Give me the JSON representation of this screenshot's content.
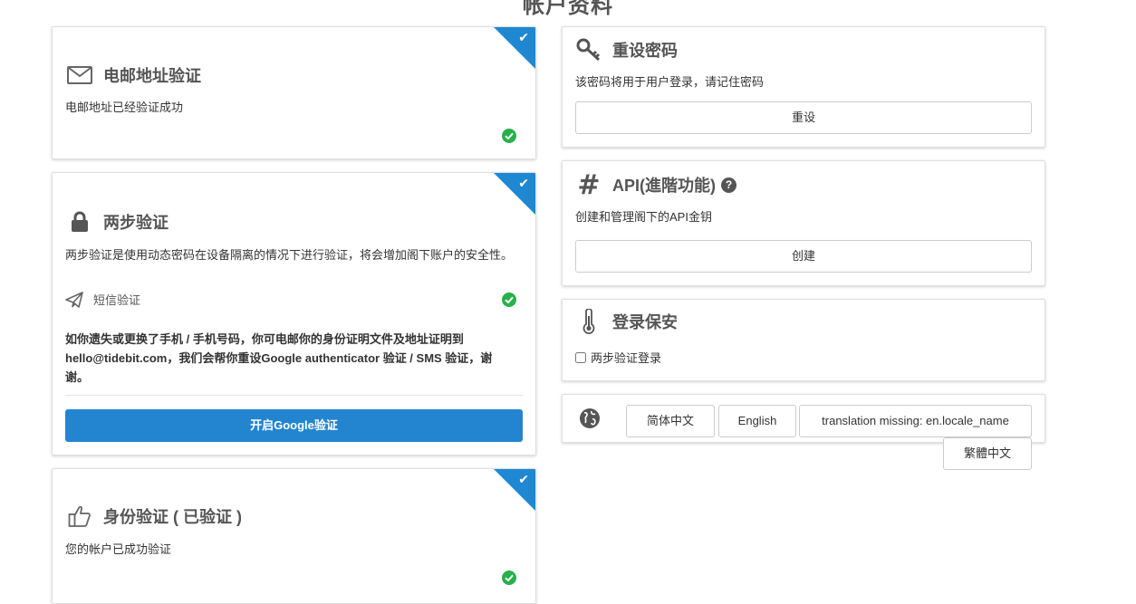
{
  "page": {
    "title": "帐户资料"
  },
  "email_card": {
    "title": "电邮地址验证",
    "desc": "电邮地址已经验证成功",
    "icon": "envelope-icon",
    "badge_icon": "check-icon"
  },
  "twofa_card": {
    "title": "两步验证",
    "desc": "两步验证是使用动态密码在设备隔离的情况下进行验证，将会增加阁下账户的安全性。",
    "sms_label": "短信验证",
    "note": "如你遗失或更换了手机 / 手机号码，你可电邮你的身份证明文件及地址证明到 hello@tidebit.com，我们会帮你重设Google authenticator 验证 / SMS 验证，谢谢。",
    "google_button": "开启Google验证",
    "icon": "lock-icon"
  },
  "identity_card": {
    "title": "身份验证 ( 已验证 )",
    "desc": "您的帐户已成功验证",
    "icon": "thumbs-up-icon"
  },
  "password_card": {
    "title": "重设密码",
    "desc": "该密码将用于用户登录，请记住密码",
    "button": "重设",
    "icon": "key-icon"
  },
  "api_card": {
    "title": "API(進階功能)",
    "desc": "创建和管理阁下的API金钥",
    "button": "创建",
    "icon": "hashtag-icon"
  },
  "login_card": {
    "title": "登录保安",
    "checkbox_label": "两步验证登录",
    "checkbox_checked": false,
    "icon": "thermometer-icon"
  },
  "language": {
    "icon": "globe-icon",
    "options": [
      "简体中文",
      "English",
      "translation missing: en.locale_name",
      "繁體中文"
    ]
  },
  "colors": {
    "accent": "#1e88d3",
    "button_primary": "#2385d0",
    "success": "#27b04b"
  }
}
